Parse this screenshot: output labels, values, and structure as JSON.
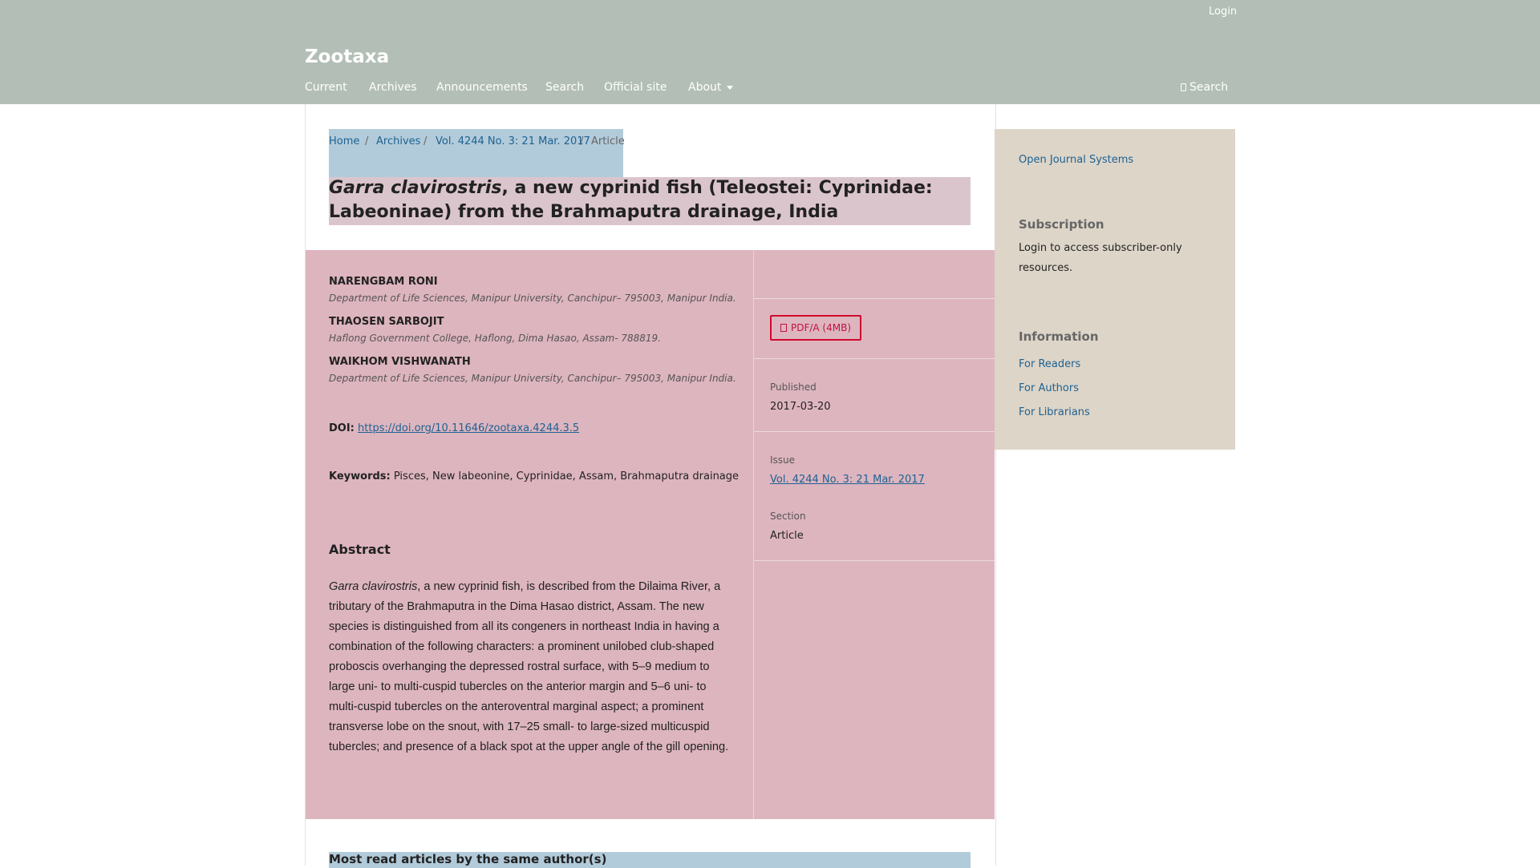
{
  "header": {
    "login": "Login",
    "site_title": "Zootaxa",
    "nav": [
      "Current",
      "Archives",
      "Announcements",
      "Search",
      "Official site",
      "About"
    ],
    "search": "Search",
    "background_color": "#b3bfb6"
  },
  "breadcrumb": {
    "home": "Home",
    "separator": "/",
    "archives": "Archives",
    "issue": "Vol. 4244 No. 3: 21 Mar. 2017",
    "current": "Article"
  },
  "article": {
    "title_species": "Garra clavirostris",
    "title_line1_rest": ", a new cyprinid fish (Teleostei: Cyprinidae:",
    "title_line2": "Labeoninae) from the Brahmaputra drainage, India",
    "authors": [
      {
        "name": "NARENGBAM RONI",
        "affiliation": "Department of Life Sciences, Manipur University, Canchipur– 795003, Manipur India."
      },
      {
        "name": "THAOSEN SARBOJIT",
        "affiliation": "Haflong Government College, Haflong, Dima Hasao, Assam- 788819."
      },
      {
        "name": "WAIKHOM VISHWANATH",
        "affiliation": "Department of Life Sciences, Manipur University, Canchipur– 795003, Manipur India."
      }
    ],
    "doi_label": "DOI:",
    "doi_url": "https://doi.org/10.11646/zootaxa.4244.3.5",
    "keywords_label": "Keywords:",
    "keywords": "Pisces, New labeonine, Cyprinidae, Assam, Brahmaputra drainage",
    "abstract_heading": "Abstract",
    "abstract_species": "Garra clavirostris",
    "abstract_rest": ", a new cyprinid fish, is described from the Dilaima River, a tributary of the Brahmaputra in the Dima Hasao district, Assam. The new species is distinguished from all its congeners in northeast India in having a combination of the following characters: a prominent unilobed club-shaped proboscis overhanging the depressed rostral surface, with 5–9 medium to large uni- to multi-cuspid tubercles on the anterior margin and 5–6 uni- to multi-cuspid tubercles on the anteroventral marginal aspect; a prominent transverse lobe on the snout, with 17–25 small- to large-sized multicuspid tubercles; and presence of a black spot at the upper angle of the gill opening."
  },
  "details": {
    "pdf_button": "PDF/A (4MB)",
    "published_label": "Published",
    "published_date": "2017-03-20",
    "issue_label": "Issue",
    "issue_link": "Vol. 4244 No. 3: 21 Mar. 2017",
    "section_label": "Section",
    "section_value": "Article"
  },
  "sidebar": {
    "ojs_link": "Open Journal Systems",
    "subscription_heading": "Subscription",
    "subscription_text": "Login to access subscriber-only resources.",
    "information_heading": "Information",
    "links": [
      "For Readers",
      "For Authors",
      "For Librarians"
    ]
  },
  "most_read_heading": "Most read articles by the same author(s)",
  "colors": {
    "link": "#1e6292",
    "article_highlight": "#ddb5bf",
    "title_highlight": "#dbc5cc",
    "breadcrumb_highlight": "#b2cbda",
    "sidebar": "#ddd5c8",
    "pdf_border": "#d00a2c"
  }
}
